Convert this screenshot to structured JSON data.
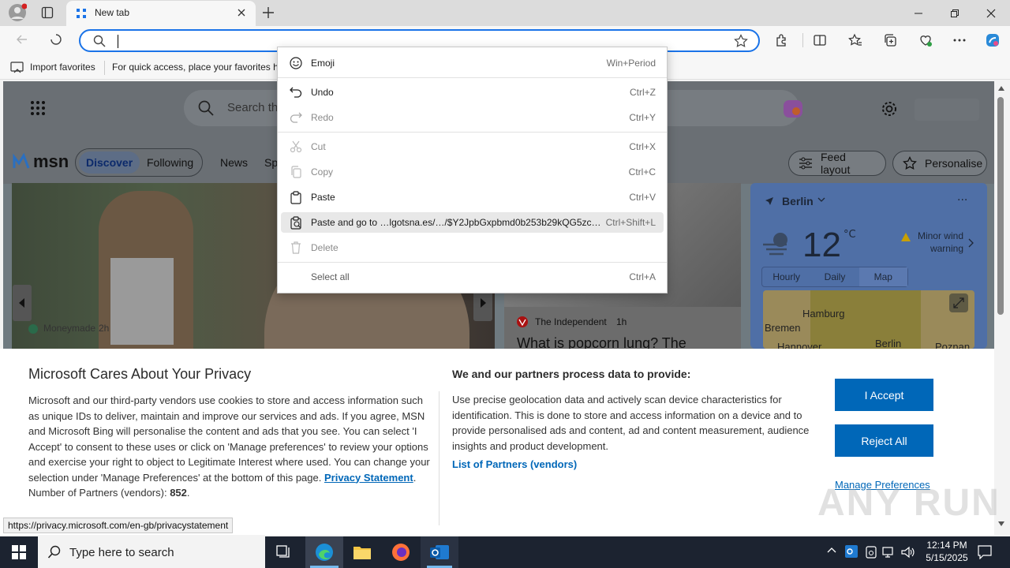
{
  "tab": {
    "title": "New tab"
  },
  "favorites": {
    "import_label": "Import favorites",
    "hint": "For quick access, place your favorites he"
  },
  "msn": {
    "search_placeholder": "Search th",
    "brand": "msn",
    "nav": [
      "Discover",
      "Following",
      "News",
      "Sp"
    ],
    "feed_layout": "Feed layout",
    "personalise": "Personalise",
    "card1": {
      "source": "Moneymade",
      "age": "2h"
    },
    "card2": {
      "source": "The Independent",
      "age": "1h",
      "headline": "What is popcorn lung? The"
    },
    "weather": {
      "city": "Berlin",
      "temp": "12",
      "unit": "°C",
      "alert": "Minor wind warning",
      "tabs": [
        "Hourly",
        "Daily",
        "Map"
      ],
      "map_labels": [
        "Hamburg",
        "Bremen",
        "Hannover",
        "Berlin",
        "Poznan"
      ]
    }
  },
  "context_menu": {
    "items": [
      {
        "label": "Emoji",
        "shortcut": "Win+Period",
        "icon": "emoji-icon",
        "enabled": true
      },
      {
        "label": "Undo",
        "shortcut": "Ctrl+Z",
        "icon": "undo-icon",
        "enabled": true
      },
      {
        "label": "Redo",
        "shortcut": "Ctrl+Y",
        "icon": "redo-icon",
        "enabled": false
      },
      {
        "label": "Cut",
        "shortcut": "Ctrl+X",
        "icon": "cut-icon",
        "enabled": false
      },
      {
        "label": "Copy",
        "shortcut": "Ctrl+C",
        "icon": "copy-icon",
        "enabled": false
      },
      {
        "label": "Paste",
        "shortcut": "Ctrl+V",
        "icon": "paste-icon",
        "enabled": true
      },
      {
        "label": "Paste and go to …lgotsna.es/…/$Y2JpbGxpbmd0b253b29kQG5zc…",
        "shortcut": "Ctrl+Shift+L",
        "icon": "paste-go-icon",
        "enabled": true
      },
      {
        "label": "Delete",
        "shortcut": "",
        "icon": "delete-icon",
        "enabled": false
      },
      {
        "label": "Select all",
        "shortcut": "Ctrl+A",
        "icon": "",
        "enabled": true
      }
    ]
  },
  "consent": {
    "title": "Microsoft Cares About Your Privacy",
    "body_left": "Microsoft and our third-party vendors use cookies to store and access information such as unique IDs to deliver, maintain and improve our services and ads. If you agree, MSN and Microsoft Bing will personalise the content and ads that you see. You can select 'I Accept' to consent to these uses or click on 'Manage preferences' to review your options and exercise your right to object to Legitimate Interest where used.  You can change your selection under 'Manage Preferences' at the bottom of this page.",
    "privacy_link": "Privacy Statement",
    "partners_label": "Number of Partners (vendors):",
    "partners_count": "852",
    "right_title": "We and our partners process data to provide:",
    "body_right": "Use precise geolocation data and actively scan device characteristics for identification. This is done to store and access information on a device and to provide personalised ads and content, ad and content measurement, audience insights and product development.",
    "partners_link": "List of Partners (vendors)",
    "accept": "I Accept",
    "reject": "Reject All",
    "manage": "Manage Preferences"
  },
  "status_url": "https://privacy.microsoft.com/en-gb/privacystatement",
  "taskbar": {
    "search_placeholder": "Type here to search",
    "time": "12:14 PM",
    "date": "5/15/2025"
  },
  "watermark": "ANY RUN",
  "colors": {
    "accent": "#0067b8",
    "omnibox_focus": "#1a73e8",
    "taskbar": "#1c2330"
  }
}
